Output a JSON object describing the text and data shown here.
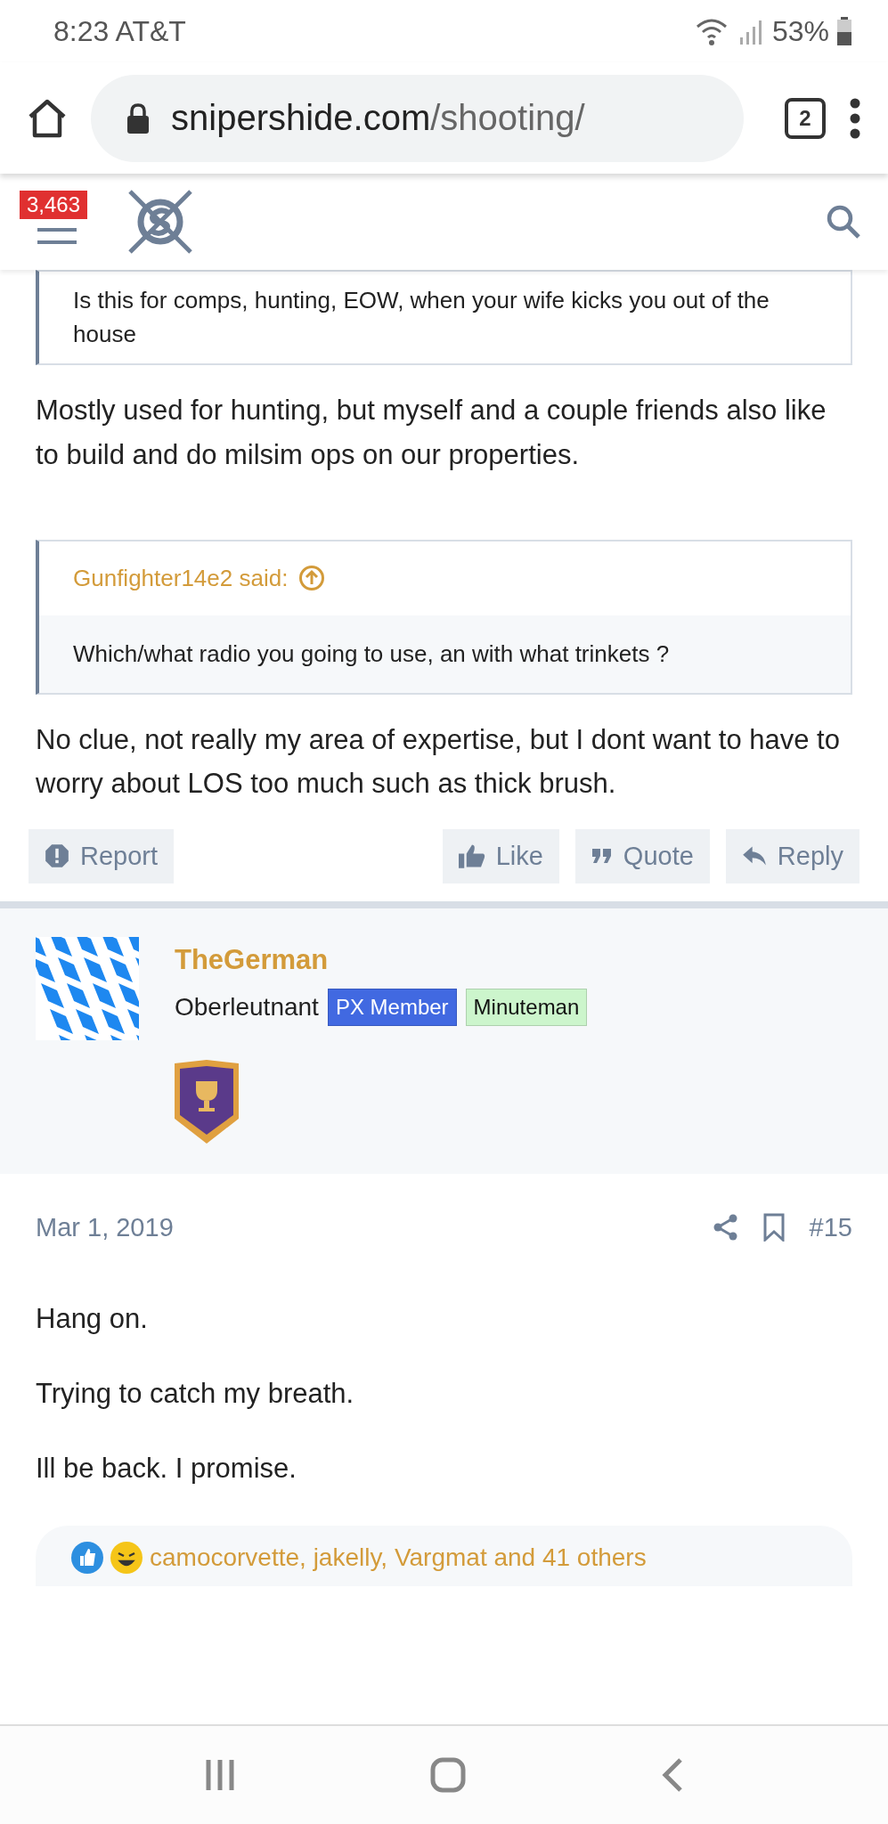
{
  "status_bar": {
    "time": "8:23",
    "carrier": "AT&T",
    "battery": "53%"
  },
  "browser": {
    "domain": "snipershide.com",
    "path": "/shooting/",
    "tab_count": "2"
  },
  "site_header": {
    "alert_count": "3,463"
  },
  "post": {
    "quote_text": "Is this for comps, hunting, EOW, when your wife kicks you out of the house",
    "reply_1": "Mostly used for hunting, but myself and a couple friends also like to build and do milsim ops on our properties.",
    "quote_author": "Gunfighter14e2 said:",
    "quote_2_text": "Which/what radio you going to use, an with what trinkets ?",
    "reply_2": "No clue, not really my area of expertise, but I dont want to have to worry about LOS too much such as thick brush.",
    "actions": [
      {
        "kind": "report",
        "label": "Report"
      },
      {
        "kind": "like",
        "label": "Like"
      },
      {
        "kind": "quote",
        "label": "Quote"
      },
      {
        "kind": "reply",
        "label": "Reply"
      }
    ]
  },
  "user": {
    "name": "TheGerman",
    "title": "Oberleutnant",
    "banners": [
      {
        "text": "PX Member",
        "color": "#4169e1"
      },
      {
        "text": "Minuteman",
        "color": "#ccf5cc"
      }
    ]
  },
  "post_2": {
    "date": "Mar 1, 2019",
    "number": "#15",
    "paragraphs": [
      "Hang on.",
      "Trying to catch my breath.",
      "Ill be back. I promise."
    ],
    "reactions": "camocorvette, jakelly, Vargmat and 41 others"
  }
}
